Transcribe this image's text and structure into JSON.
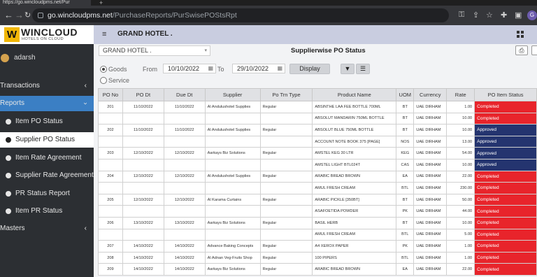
{
  "browser": {
    "tab_title": "https://go.wincloudpms.net/Pur",
    "url_host": "go.wincloudpms.net",
    "url_path": "/PurchaseReports/PurSwisePOStsRpt",
    "profile_initial": "G"
  },
  "logo": {
    "name": "WINCLOUD",
    "tagline": "HOTELS ON CLOUD",
    "mark": "W"
  },
  "user": {
    "name": "adarsh"
  },
  "sidebar": {
    "transactions": "Transactions",
    "reports": "Reports",
    "items": [
      "Item PO Status",
      "Supplier PO Status",
      "Item Rate Agreement",
      "Supplier Rate Agreement",
      "PR Status Report",
      "Item PR Status"
    ],
    "masters": "Masters"
  },
  "header": {
    "hotel": "GRAND HOTEL ."
  },
  "filters": {
    "hotel_select": "GRAND HOTEL .",
    "title": "Supplierwise PO Status",
    "goods_label": "Goods",
    "service_label": "Service",
    "from_label": "From",
    "from_date": "10/10/2022",
    "to_label": "To",
    "to_date": "29/10/2022",
    "display_label": "Display"
  },
  "table": {
    "columns": [
      "PO No",
      "PO Dt",
      "Due Dt",
      "Supplier",
      "Po Trn Type",
      "Product Name",
      "UOM",
      "Currency",
      "Rate",
      "PO Item Status"
    ],
    "rows": [
      [
        "201",
        "11/10/2022",
        "11/10/2022",
        "Al Andulushotel Supplies",
        "Regular",
        "ABSINTHE LAA FEE BOTTLE 700ML",
        "BT",
        "UAE DIRHAM",
        "1.00",
        "Completed"
      ],
      [
        "",
        "",
        "",
        "",
        "",
        "ABSOLUT MANDARIN 750ML BOTTLE",
        "BT",
        "UAE DIRHAM",
        "10.00",
        "Completed"
      ],
      [
        "202",
        "11/10/2022",
        "11/10/2022",
        "Al Andulushotel Supplies",
        "Regular",
        "ABSOLUT BLUE 750ML BOTTLE",
        "BT",
        "UAE DIRHAM",
        "10.00",
        "Approved"
      ],
      [
        "",
        "",
        "",
        "",
        "",
        "ACCOUNT NOTE BOOK 375 [PAGE]",
        "NOS",
        "UAE DIRHAM",
        "13.00",
        "Approved"
      ],
      [
        "203",
        "12/10/2022",
        "12/10/2022",
        "Aarkays Biz Solutions",
        "Regular",
        "AMSTEL KEG 30 LTR",
        "KEG",
        "UAE DIRHAM",
        "54.00",
        "Approved"
      ],
      [
        "",
        "",
        "",
        "",
        "",
        "AMSTEL LIGHT BTL024T",
        "CAS",
        "UAE DIRHAM",
        "10.00",
        "Approved"
      ],
      [
        "204",
        "12/10/2022",
        "12/10/2022",
        "Al Andulushotel Supplies",
        "Regular",
        "ARABIC BREAD BROWN",
        "EA",
        "UAE DIRHAM",
        "22.00",
        "Completed"
      ],
      [
        "",
        "",
        "",
        "",
        "",
        "AMUL FRESH CREAM",
        "BTL",
        "UAE DIRHAM",
        "230.00",
        "Completed"
      ],
      [
        "205",
        "12/10/2022",
        "12/10/2022",
        "Al Karama Curtains",
        "Regular",
        "ARABIC PICKLE [350BT]",
        "BT",
        "UAE DIRHAM",
        "50.00",
        "Completed"
      ],
      [
        "",
        "",
        "",
        "",
        "",
        "ASAFOETIDA POWDER",
        "PK",
        "UAE DIRHAM",
        "44.00",
        "Completed"
      ],
      [
        "206",
        "13/10/2022",
        "13/10/2022",
        "Aarkays Biz Solutions",
        "Regular",
        "BASIL HERB",
        "BT",
        "UAE DIRHAM",
        "10.00",
        "Completed"
      ],
      [
        "",
        "",
        "",
        "",
        "",
        "AMUL FRESH CREAM",
        "BTL",
        "UAE DIRHAM",
        "5.00",
        "Completed"
      ],
      [
        "207",
        "14/10/2022",
        "14/10/2022",
        "Advance Baking Concepts",
        "Regular",
        "A4 XEROX PAPER",
        "PK",
        "UAE DIRHAM",
        "1.00",
        "Completed"
      ],
      [
        "208",
        "14/10/2022",
        "14/10/2022",
        "Al Adnan Veg-Fruits Shop",
        "Regular",
        "100 PIPERS",
        "BTL",
        "UAE DIRHAM",
        "1.00",
        "Completed"
      ],
      [
        "209",
        "14/10/2022",
        "14/10/2022",
        "Aarkays Biz Solutions",
        "Regular",
        "ARABIC BREAD BROWN",
        "EA",
        "UAE DIRHAM",
        "22.00",
        "Completed"
      ]
    ]
  },
  "colors": {
    "completed": "#e8242b",
    "approved": "#24346f",
    "sidebar_active": "#3b7fc4"
  }
}
